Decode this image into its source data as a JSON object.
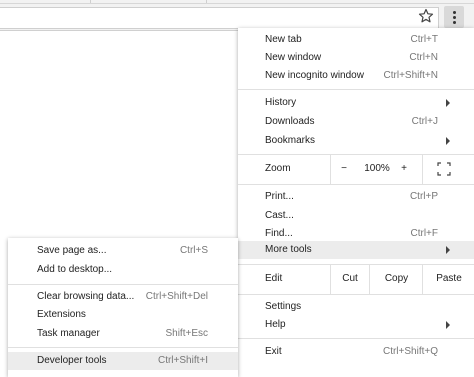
{
  "browser": {
    "star_icon": "star-icon",
    "menu_icon": "vertical-ellipsis-icon"
  },
  "main_menu": {
    "new_tab": {
      "label": "New tab",
      "shortcut": "Ctrl+T"
    },
    "new_window": {
      "label": "New window",
      "shortcut": "Ctrl+N"
    },
    "new_incognito": {
      "label": "New incognito window",
      "shortcut": "Ctrl+Shift+N"
    },
    "history": {
      "label": "History"
    },
    "downloads": {
      "label": "Downloads",
      "shortcut": "Ctrl+J"
    },
    "bookmarks": {
      "label": "Bookmarks"
    },
    "zoom": {
      "label": "Zoom",
      "minus": "−",
      "value": "100%",
      "plus": "+",
      "fullscreen_icon": "fullscreen-icon"
    },
    "print": {
      "label": "Print...",
      "shortcut": "Ctrl+P"
    },
    "cast": {
      "label": "Cast..."
    },
    "find": {
      "label": "Find...",
      "shortcut": "Ctrl+F"
    },
    "more_tools": {
      "label": "More tools"
    },
    "edit": {
      "label": "Edit",
      "cut": "Cut",
      "copy": "Copy",
      "paste": "Paste"
    },
    "settings": {
      "label": "Settings"
    },
    "help": {
      "label": "Help"
    },
    "exit": {
      "label": "Exit",
      "shortcut": "Ctrl+Shift+Q"
    }
  },
  "more_tools_menu": {
    "save_page": {
      "label": "Save page as...",
      "shortcut": "Ctrl+S"
    },
    "add_to_desktop": {
      "label": "Add to desktop..."
    },
    "clear_browsing": {
      "label": "Clear browsing data...",
      "shortcut": "Ctrl+Shift+Del"
    },
    "extensions": {
      "label": "Extensions"
    },
    "task_manager": {
      "label": "Task manager",
      "shortcut": "Shift+Esc"
    },
    "developer_tools": {
      "label": "Developer tools",
      "shortcut": "Ctrl+Shift+I"
    }
  }
}
